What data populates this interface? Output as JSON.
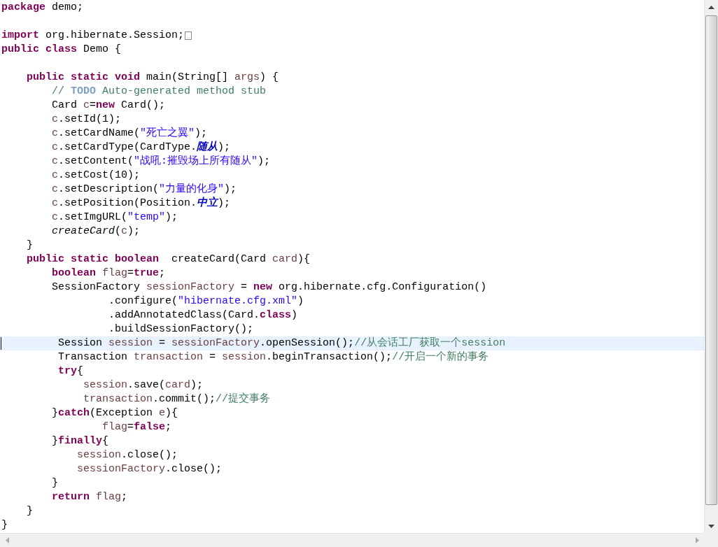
{
  "editor": {
    "lines": [
      {
        "kind": "code",
        "current": false,
        "tokens": [
          {
            "text": "package",
            "kind": "keyword"
          },
          {
            "text": " demo;",
            "kind": "plain"
          }
        ]
      },
      {
        "kind": "blank",
        "current": false
      },
      {
        "kind": "folded",
        "current": false,
        "tokens": [
          {
            "text": "import",
            "kind": "keyword"
          },
          {
            "text": " org.hibernate.Session;",
            "kind": "plain"
          }
        ]
      },
      {
        "kind": "code",
        "current": false,
        "tokens": [
          {
            "text": "public class",
            "kind": "keyword"
          },
          {
            "text": " Demo {",
            "kind": "plain"
          }
        ]
      },
      {
        "kind": "blank",
        "current": false
      },
      {
        "kind": "code",
        "current": false,
        "tokens": [
          {
            "text": "    public static void",
            "kind": "keyword"
          },
          {
            "text": " main(String[] ",
            "kind": "plain"
          },
          {
            "text": "args",
            "kind": "variable"
          },
          {
            "text": ") {",
            "kind": "plain"
          }
        ]
      },
      {
        "kind": "code",
        "current": false,
        "tokens": [
          {
            "text": "        // ",
            "kind": "comment"
          },
          {
            "text": "TODO",
            "kind": "todo"
          },
          {
            "text": " Auto-generated method stub",
            "kind": "comment"
          }
        ]
      },
      {
        "kind": "code",
        "current": false,
        "tokens": [
          {
            "text": "        Card ",
            "kind": "plain"
          },
          {
            "text": "c",
            "kind": "variable"
          },
          {
            "text": "=",
            "kind": "plain"
          },
          {
            "text": "new",
            "kind": "keyword"
          },
          {
            "text": " Card();",
            "kind": "plain"
          }
        ]
      },
      {
        "kind": "code",
        "current": false,
        "tokens": [
          {
            "text": "        c",
            "kind": "variable"
          },
          {
            "text": ".setId(1);",
            "kind": "plain"
          }
        ]
      },
      {
        "kind": "code",
        "current": false,
        "tokens": [
          {
            "text": "        c",
            "kind": "variable"
          },
          {
            "text": ".setCardName(",
            "kind": "plain"
          },
          {
            "text": "\"死亡之翼\"",
            "kind": "string"
          },
          {
            "text": ");",
            "kind": "plain"
          }
        ]
      },
      {
        "kind": "code",
        "current": false,
        "tokens": [
          {
            "text": "        c",
            "kind": "variable"
          },
          {
            "text": ".setCardType(CardType.",
            "kind": "plain"
          },
          {
            "text": "随从",
            "kind": "constant"
          },
          {
            "text": ");",
            "kind": "plain"
          }
        ]
      },
      {
        "kind": "code",
        "current": false,
        "tokens": [
          {
            "text": "        c",
            "kind": "variable"
          },
          {
            "text": ".setContent(",
            "kind": "plain"
          },
          {
            "text": "\"战吼:摧毁场上所有随从\"",
            "kind": "string"
          },
          {
            "text": ");",
            "kind": "plain"
          }
        ]
      },
      {
        "kind": "code",
        "current": false,
        "tokens": [
          {
            "text": "        c",
            "kind": "variable"
          },
          {
            "text": ".setCost(10);",
            "kind": "plain"
          }
        ]
      },
      {
        "kind": "code",
        "current": false,
        "tokens": [
          {
            "text": "        c",
            "kind": "variable"
          },
          {
            "text": ".setDescription(",
            "kind": "plain"
          },
          {
            "text": "\"力量的化身\"",
            "kind": "string"
          },
          {
            "text": ");",
            "kind": "plain"
          }
        ]
      },
      {
        "kind": "code",
        "current": false,
        "tokens": [
          {
            "text": "        c",
            "kind": "variable"
          },
          {
            "text": ".setPosition(Position.",
            "kind": "plain"
          },
          {
            "text": "中立",
            "kind": "constant"
          },
          {
            "text": ");",
            "kind": "plain"
          }
        ]
      },
      {
        "kind": "code",
        "current": false,
        "tokens": [
          {
            "text": "        c",
            "kind": "variable"
          },
          {
            "text": ".setImgURL(",
            "kind": "plain"
          },
          {
            "text": "\"temp\"",
            "kind": "string"
          },
          {
            "text": ");",
            "kind": "plain"
          }
        ]
      },
      {
        "kind": "code",
        "current": false,
        "tokens": [
          {
            "text": "        createCard",
            "kind": "static"
          },
          {
            "text": "(",
            "kind": "plain"
          },
          {
            "text": "c",
            "kind": "variable"
          },
          {
            "text": ");",
            "kind": "plain"
          }
        ]
      },
      {
        "kind": "code",
        "current": false,
        "tokens": [
          {
            "text": "    }",
            "kind": "plain"
          }
        ]
      },
      {
        "kind": "code",
        "current": false,
        "tokens": [
          {
            "text": "    public static boolean",
            "kind": "keyword"
          },
          {
            "text": "  createCard(Card ",
            "kind": "plain"
          },
          {
            "text": "card",
            "kind": "variable"
          },
          {
            "text": "){",
            "kind": "plain"
          }
        ]
      },
      {
        "kind": "code",
        "current": false,
        "tokens": [
          {
            "text": "        boolean",
            "kind": "keyword"
          },
          {
            "text": " flag",
            "kind": "variable"
          },
          {
            "text": "=",
            "kind": "plain"
          },
          {
            "text": "true",
            "kind": "keyword"
          },
          {
            "text": ";",
            "kind": "plain"
          }
        ]
      },
      {
        "kind": "code",
        "current": false,
        "tokens": [
          {
            "text": "        SessionFactory ",
            "kind": "plain"
          },
          {
            "text": "sessionFactory",
            "kind": "variable"
          },
          {
            "text": " = ",
            "kind": "plain"
          },
          {
            "text": "new",
            "kind": "keyword"
          },
          {
            "text": " org.hibernate.cfg.Configuration()",
            "kind": "plain"
          }
        ]
      },
      {
        "kind": "code",
        "current": false,
        "tokens": [
          {
            "text": "                 .configure(",
            "kind": "plain"
          },
          {
            "text": "\"hibernate.cfg.xml\"",
            "kind": "string"
          },
          {
            "text": ")",
            "kind": "plain"
          }
        ]
      },
      {
        "kind": "code",
        "current": false,
        "tokens": [
          {
            "text": "                 .addAnnotatedClass(Card.",
            "kind": "plain"
          },
          {
            "text": "class",
            "kind": "keyword"
          },
          {
            "text": ")",
            "kind": "plain"
          }
        ]
      },
      {
        "kind": "code",
        "current": false,
        "tokens": [
          {
            "text": "                 .buildSessionFactory();",
            "kind": "plain"
          }
        ]
      },
      {
        "kind": "code",
        "current": true,
        "tokens": [
          {
            "text": "         Session ",
            "kind": "plain"
          },
          {
            "text": "session",
            "kind": "variable"
          },
          {
            "text": " = ",
            "kind": "plain"
          },
          {
            "text": "sessionFactory",
            "kind": "variable"
          },
          {
            "text": ".openSession();",
            "kind": "plain"
          },
          {
            "text": "//从会话工厂获取一个session",
            "kind": "comment"
          }
        ]
      },
      {
        "kind": "code",
        "current": false,
        "tokens": [
          {
            "text": "         Transaction ",
            "kind": "plain"
          },
          {
            "text": "transaction",
            "kind": "variable"
          },
          {
            "text": " = ",
            "kind": "plain"
          },
          {
            "text": "session",
            "kind": "variable"
          },
          {
            "text": ".beginTransaction();",
            "kind": "plain"
          },
          {
            "text": "//开启一个新的事务",
            "kind": "comment"
          }
        ]
      },
      {
        "kind": "code",
        "current": false,
        "tokens": [
          {
            "text": "         try",
            "kind": "keyword"
          },
          {
            "text": "{",
            "kind": "plain"
          }
        ]
      },
      {
        "kind": "code",
        "current": false,
        "tokens": [
          {
            "text": "             session",
            "kind": "variable"
          },
          {
            "text": ".save(",
            "kind": "plain"
          },
          {
            "text": "card",
            "kind": "variable"
          },
          {
            "text": ");",
            "kind": "plain"
          }
        ]
      },
      {
        "kind": "code",
        "current": false,
        "tokens": [
          {
            "text": "             transaction",
            "kind": "variable"
          },
          {
            "text": ".commit();",
            "kind": "plain"
          },
          {
            "text": "//提交事务",
            "kind": "comment"
          }
        ]
      },
      {
        "kind": "code",
        "current": false,
        "tokens": [
          {
            "text": "        }",
            "kind": "plain"
          },
          {
            "text": "catch",
            "kind": "keyword"
          },
          {
            "text": "(Exception ",
            "kind": "plain"
          },
          {
            "text": "e",
            "kind": "variable"
          },
          {
            "text": "){",
            "kind": "plain"
          }
        ]
      },
      {
        "kind": "code",
        "current": false,
        "tokens": [
          {
            "text": "                flag",
            "kind": "variable"
          },
          {
            "text": "=",
            "kind": "plain"
          },
          {
            "text": "false",
            "kind": "keyword"
          },
          {
            "text": ";",
            "kind": "plain"
          }
        ]
      },
      {
        "kind": "code",
        "current": false,
        "tokens": [
          {
            "text": "        }",
            "kind": "plain"
          },
          {
            "text": "finally",
            "kind": "keyword"
          },
          {
            "text": "{",
            "kind": "plain"
          }
        ]
      },
      {
        "kind": "code",
        "current": false,
        "tokens": [
          {
            "text": "            session",
            "kind": "variable"
          },
          {
            "text": ".close();",
            "kind": "plain"
          }
        ]
      },
      {
        "kind": "code",
        "current": false,
        "tokens": [
          {
            "text": "            sessionFactory",
            "kind": "variable"
          },
          {
            "text": ".close();",
            "kind": "plain"
          }
        ]
      },
      {
        "kind": "code",
        "current": false,
        "tokens": [
          {
            "text": "        }",
            "kind": "plain"
          }
        ]
      },
      {
        "kind": "code",
        "current": false,
        "tokens": [
          {
            "text": "        return",
            "kind": "keyword"
          },
          {
            "text": " flag",
            "kind": "variable"
          },
          {
            "text": ";",
            "kind": "plain"
          }
        ]
      },
      {
        "kind": "code",
        "current": false,
        "tokens": [
          {
            "text": "    }",
            "kind": "plain"
          }
        ]
      },
      {
        "kind": "code",
        "current": false,
        "tokens": [
          {
            "text": "}",
            "kind": "plain"
          }
        ]
      }
    ]
  }
}
